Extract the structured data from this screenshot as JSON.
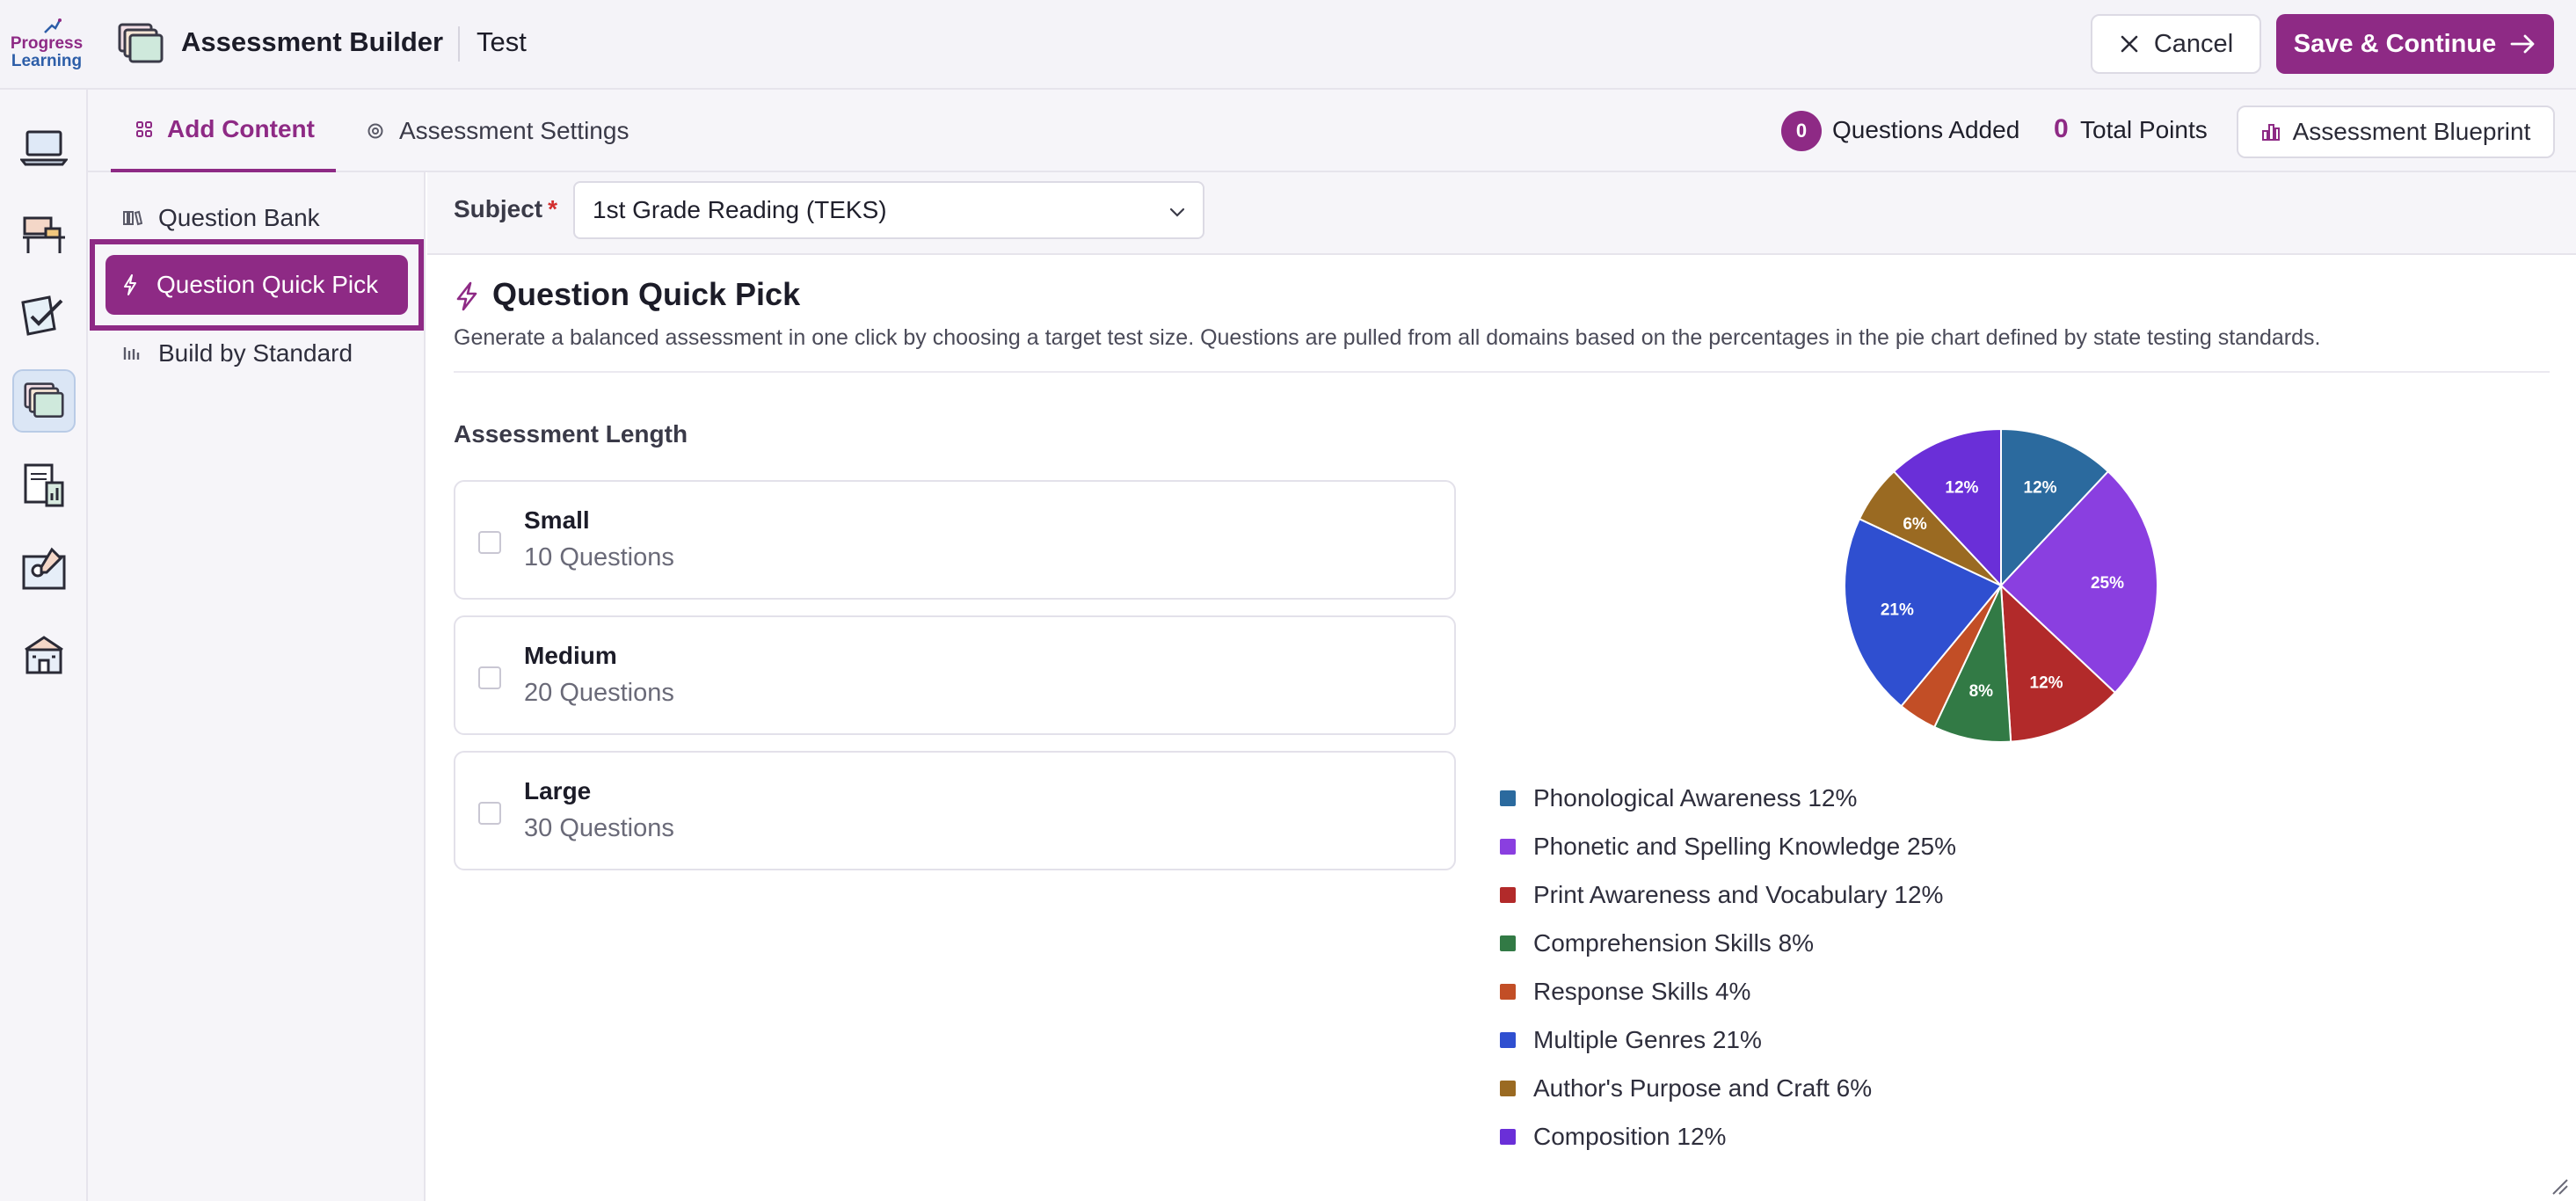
{
  "header": {
    "logo_line1": "Progress",
    "logo_line2": "Learning",
    "app_title": "Assessment Builder",
    "sub_title": "Test",
    "cancel_label": "Cancel",
    "save_label": "Save & Continue"
  },
  "rail": {
    "items": [
      {
        "icon": "laptop-icon"
      },
      {
        "icon": "classroom-icon"
      },
      {
        "icon": "assignment-icon"
      },
      {
        "icon": "assessment-builder-icon",
        "active": true
      },
      {
        "icon": "reports-icon"
      },
      {
        "icon": "teacher-tools-icon"
      },
      {
        "icon": "school-icon"
      }
    ]
  },
  "tabs": [
    {
      "label": "Add Content",
      "active": true,
      "icon": "grid-icon"
    },
    {
      "label": "Assessment Settings",
      "active": false,
      "icon": "gear-icon"
    }
  ],
  "summary": {
    "questions_added_count": "0",
    "questions_added_label": "Questions Added",
    "total_points_count": "0",
    "total_points_label": "Total Points",
    "blueprint_label": "Assessment Blueprint"
  },
  "subnav": {
    "items": [
      {
        "label": "Question Bank",
        "icon": "library-icon"
      },
      {
        "label": "Question Quick Pick",
        "icon": "bolt-icon",
        "active": true
      },
      {
        "label": "Build by Standard",
        "icon": "bars-icon"
      }
    ]
  },
  "subject": {
    "label": "Subject",
    "required_mark": "*",
    "value": "1st Grade Reading (TEKS)"
  },
  "quick_pick": {
    "title": "Question Quick Pick",
    "description": "Generate a balanced assessment in one click by choosing a target test size. Questions are pulled from all domains based on the percentages in the pie chart defined by state testing standards.",
    "length_label": "Assessment Length",
    "options": [
      {
        "name": "Small",
        "count": "10 Questions",
        "checked": false
      },
      {
        "name": "Medium",
        "count": "20 Questions",
        "checked": false
      },
      {
        "name": "Large",
        "count": "30 Questions",
        "checked": false
      }
    ]
  },
  "colors": {
    "brand": "#8e2a85",
    "accent_blue": "#2d5ea8"
  },
  "chart_data": {
    "type": "pie",
    "slices": [
      {
        "label": "Phonological Awareness",
        "value": 12,
        "display": "12%",
        "legend": "Phonological Awareness 12%",
        "color": "#2b6a9e"
      },
      {
        "label": "Phonetic and Spelling Knowledge",
        "value": 25,
        "display": "25%",
        "legend": "Phonetic and Spelling Knowledge 25%",
        "color": "#8a3fe0"
      },
      {
        "label": "Print Awareness and Vocabulary",
        "value": 12,
        "display": "12%",
        "legend": "Print Awareness and Vocabulary 12%",
        "color": "#b22a2a"
      },
      {
        "label": "Comprehension Skills",
        "value": 8,
        "display": "8%",
        "legend": "Comprehension Skills 8%",
        "color": "#327a45"
      },
      {
        "label": "Response Skills",
        "value": 4,
        "display": "",
        "legend": "Response Skills 4%",
        "color": "#c24e26"
      },
      {
        "label": "Multiple Genres",
        "value": 21,
        "display": "21%",
        "legend": "Multiple Genres 21%",
        "color": "#2f4fd0"
      },
      {
        "label": "Author's Purpose and Craft",
        "value": 6,
        "display": "6%",
        "legend": "Author's Purpose and Craft 6%",
        "color": "#9a6a22"
      },
      {
        "label": "Composition",
        "value": 12,
        "display": "12%",
        "legend": "Composition 12%",
        "color": "#6a2fd8"
      }
    ],
    "legend_position": "bottom"
  }
}
